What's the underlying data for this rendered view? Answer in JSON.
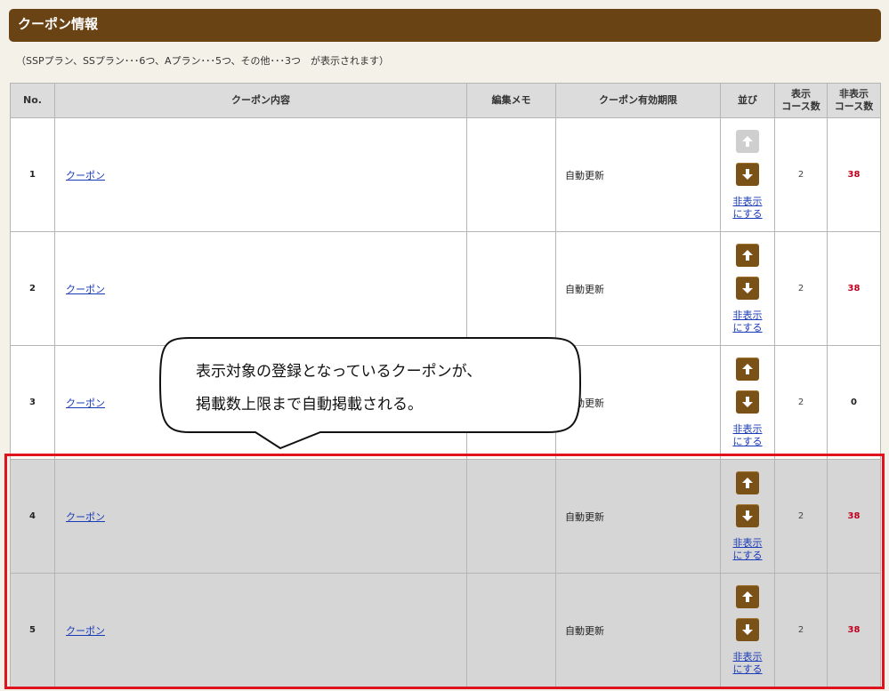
{
  "header": {
    "title": "クーポン情報"
  },
  "note": "（SSPプラン、SSプラン･･･6つ、Aプラン･･･5つ、その他･･･3つ　が表示されます）",
  "table": {
    "columns": [
      "No.",
      "クーポン内容",
      "編集メモ",
      "クーポン有効期限",
      "並び",
      "表示\nコース数",
      "非表示\nコース数"
    ],
    "rows": [
      {
        "no": "1",
        "coupon": "クーポン",
        "memo": "",
        "expiry": "自動更新",
        "hide_link": "非表示\nにする",
        "display_count": "2",
        "hidden_count": "38"
      },
      {
        "no": "2",
        "coupon": "クーポン",
        "memo": "",
        "expiry": "自動更新",
        "hide_link": "非表示\nにする",
        "display_count": "2",
        "hidden_count": "38"
      },
      {
        "no": "3",
        "coupon": "クーポン",
        "memo": "",
        "expiry": "自動更新",
        "hide_link": "非表示\nにする",
        "display_count": "2",
        "hidden_count": "0"
      },
      {
        "no": "4",
        "coupon": "クーポン",
        "memo": "",
        "expiry": "自動更新",
        "hide_link": "非表示\nにする",
        "display_count": "2",
        "hidden_count": "38"
      },
      {
        "no": "5",
        "coupon": "クーポン",
        "memo": "",
        "expiry": "自動更新",
        "hide_link": "非表示\nにする",
        "display_count": "2",
        "hidden_count": "38"
      }
    ]
  },
  "callout": {
    "line1": "表示対象の登録となっているクーポンが、",
    "line2": "掲載数上限まで自動掲載される。"
  },
  "colors": {
    "header": "#6a4315",
    "button": "#7a5218",
    "highlight": "#e0141e",
    "red_count": "#c0001e",
    "link": "#1a3ab8"
  },
  "icons": {
    "up": "arrow-up-icon",
    "down": "arrow-down-icon"
  }
}
